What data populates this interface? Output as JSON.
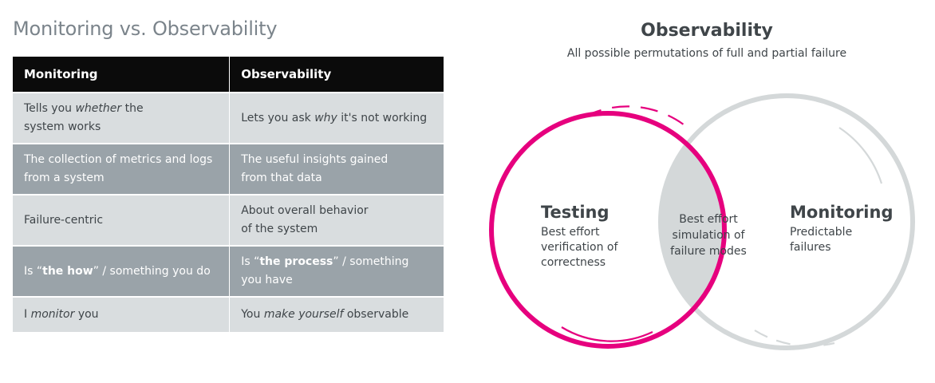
{
  "left_title": "Monitoring vs. Observability",
  "table": {
    "headers": [
      "Monitoring",
      "Observability"
    ],
    "rows": [
      {
        "style": "light",
        "monitoring": [
          "Tells you ",
          "whether",
          " the\nsystem works"
        ],
        "observability": [
          "Lets you ask ",
          "why",
          " it's not working"
        ]
      },
      {
        "style": "dark",
        "monitoring": [
          "The collection of metrics and logs\nfrom a system"
        ],
        "observability": [
          "The useful insights gained\nfrom that data"
        ]
      },
      {
        "style": "light",
        "monitoring": [
          "Failure-centric"
        ],
        "observability": [
          "About overall behavior\nof the system"
        ]
      },
      {
        "style": "dark",
        "monitoring": [
          "Is “",
          "the how",
          "” / something you do"
        ],
        "observability": [
          "Is “",
          "the process",
          "” / something\nyou have"
        ]
      },
      {
        "style": "light",
        "monitoring": [
          "I ",
          "monitor",
          " you"
        ],
        "observability": [
          "You ",
          "make yourself",
          " observable"
        ]
      }
    ]
  },
  "venn": {
    "title": "Observability",
    "subtitle": "All possible permutations of full and partial failure",
    "left": {
      "heading": "Testing",
      "desc": "Best effort\nverification of\ncorrectness",
      "color": "#e6007e"
    },
    "right": {
      "heading": "Monitoring",
      "desc": "Predictable\nfailures",
      "color": "#d4d8d9"
    },
    "overlap": {
      "text": "Best effort\nsimulation of\nfailure modes",
      "color": "#d4d8d9"
    }
  }
}
